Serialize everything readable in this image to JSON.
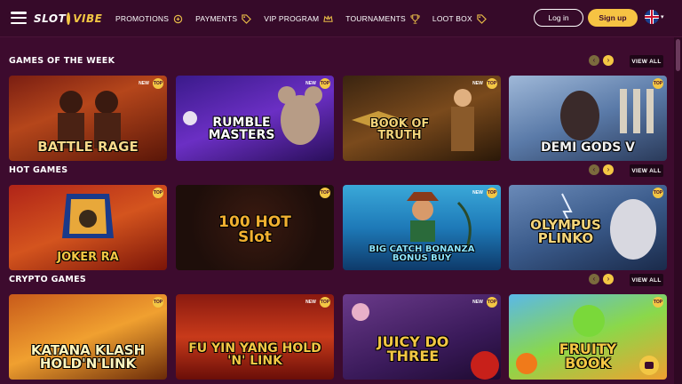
{
  "header": {
    "logo_part1": "SLOT",
    "logo_part2": "VIBE",
    "nav": [
      {
        "label": "PROMOTIONS",
        "icon": "promotions-icon"
      },
      {
        "label": "PAYMENTS",
        "icon": "tag-icon"
      },
      {
        "label": "VIP PROGRAM",
        "icon": "crown-icon"
      },
      {
        "label": "TOURNAMENTS",
        "icon": "trophy-icon"
      },
      {
        "label": "LOOT BOX",
        "icon": "tag-icon"
      }
    ],
    "login_label": "Log in",
    "signup_label": "Sign up",
    "language_icon": "uk-flag-icon"
  },
  "colors": {
    "background": "#3d0b2e",
    "accent": "#f6c343",
    "header": "#360a29"
  },
  "sections": [
    {
      "title": "GAMES OF THE WEEK",
      "view_all": "VIEW ALL",
      "games": [
        {
          "name": "BATTLE RAGE",
          "badges": [
            "NEW",
            "TOP"
          ]
        },
        {
          "name": "RUMBLE MASTERS",
          "badges": [
            "NEW",
            "TOP"
          ]
        },
        {
          "name": "BOOK OF TRUTH",
          "badges": [
            "NEW",
            "TOP"
          ]
        },
        {
          "name": "DEMI GODS V",
          "badges": [
            "TOP"
          ]
        }
      ]
    },
    {
      "title": "HOT GAMES",
      "view_all": "VIEW ALL",
      "games": [
        {
          "name": "JOKER RA",
          "badges": [
            "TOP"
          ]
        },
        {
          "name": "100 HOT Slot",
          "badges": [
            "TOP"
          ]
        },
        {
          "name": "BIG CATCH BONANZA BONUS BUY",
          "badges": [
            "NEW",
            "TOP"
          ]
        },
        {
          "name": "OLYMPUS PLINKO",
          "badges": [
            "TOP"
          ]
        }
      ]
    },
    {
      "title": "CRYPTO GAMES",
      "view_all": "VIEW ALL",
      "games": [
        {
          "name": "KATANA KLASH HOLD'N'LINK",
          "badges": [
            "TOP"
          ]
        },
        {
          "name": "FU YIN YANG HOLD 'N' LINK",
          "badges": [
            "NEW",
            "TOP"
          ]
        },
        {
          "name": "JUICY DO THREE",
          "badges": [
            "NEW",
            "TOP"
          ]
        },
        {
          "name": "FRUITY BOOK",
          "badges": [
            "TOP"
          ]
        }
      ]
    }
  ]
}
